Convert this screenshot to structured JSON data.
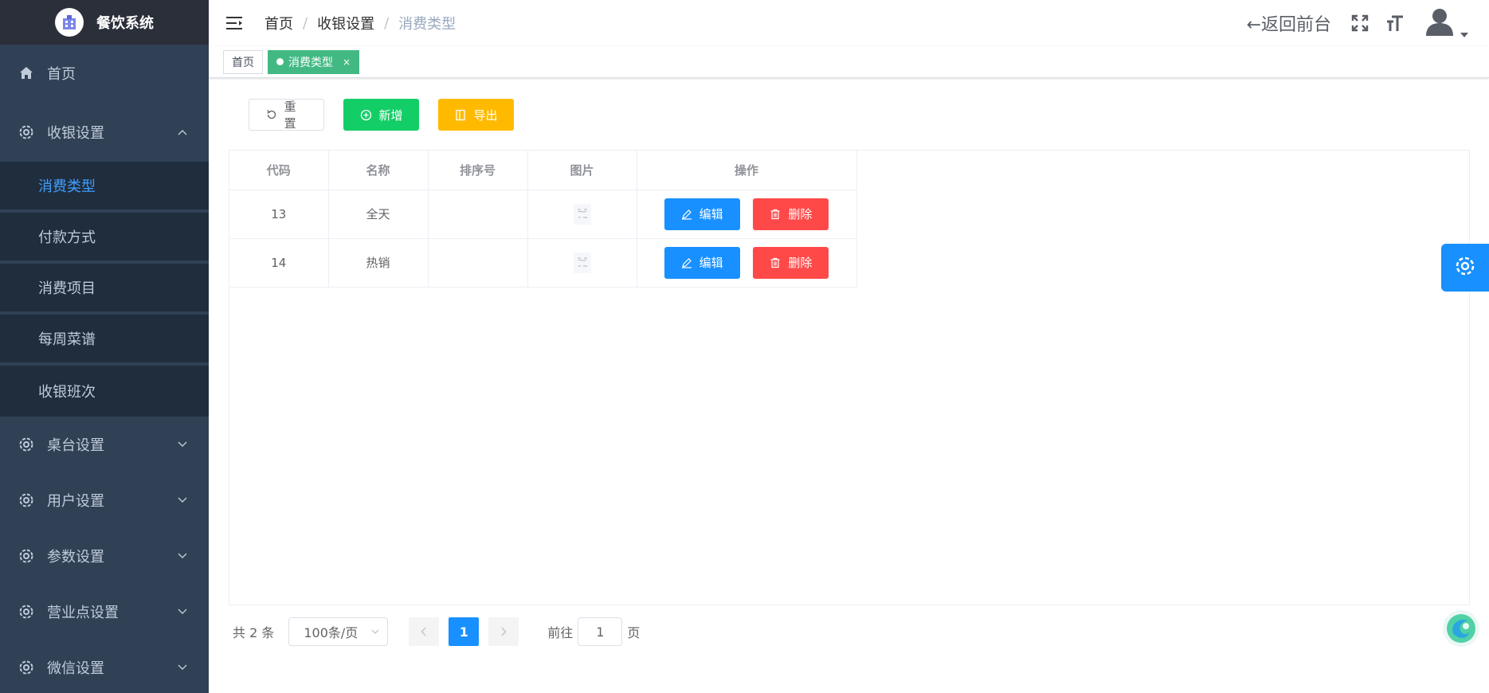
{
  "app": {
    "title": "餐饮系统"
  },
  "sidebar": {
    "home": {
      "label": "首页",
      "icon": "home-icon"
    },
    "cashier": {
      "label": "收银设置",
      "icon": "gear-icon",
      "children": [
        "消费类型",
        "付款方式",
        "消费项目",
        "每周菜谱",
        "收银班次"
      ],
      "active": "消费类型"
    },
    "groups": [
      {
        "label": "桌台设置",
        "icon": "gear-icon"
      },
      {
        "label": "用户设置",
        "icon": "gear-icon"
      },
      {
        "label": "参数设置",
        "icon": "gear-icon"
      },
      {
        "label": "营业点设置",
        "icon": "gear-icon"
      },
      {
        "label": "微信设置",
        "icon": "gear-icon"
      }
    ]
  },
  "topbar": {
    "breadcrumb": [
      "首页",
      "收银设置",
      "消费类型"
    ],
    "separator": "/",
    "back_label": "←返回前台",
    "icons": [
      "fullscreen-icon",
      "font-size-icon",
      "avatar-icon"
    ]
  },
  "tags": {
    "home": "首页",
    "active": "消费类型",
    "close": "×"
  },
  "toolbar": {
    "reset_label": "重置",
    "add_label": "新增",
    "export_label": "导出"
  },
  "table": {
    "columns": [
      "代码",
      "名称",
      "排序号",
      "图片",
      "操作"
    ],
    "rows": [
      {
        "code": "13",
        "name": "全天",
        "sort": ""
      },
      {
        "code": "14",
        "name": "热销",
        "sort": ""
      }
    ],
    "edit_label": "编辑",
    "delete_label": "删除"
  },
  "pagination": {
    "total_label": "共 2 条",
    "page_size": "100条/页",
    "current_page": "1",
    "goto_label": "前往",
    "goto_value": "1",
    "page_suffix": "页"
  },
  "colors": {
    "sidebar_bg": "#304156",
    "sidebar_sub_bg": "#1f2d3d",
    "active_menu": "#409eff",
    "tag_active": "#42b983",
    "add_button": "#13ce66",
    "export_button": "#ffba00",
    "edit_button": "#1890ff",
    "delete_button": "#ff4949"
  }
}
